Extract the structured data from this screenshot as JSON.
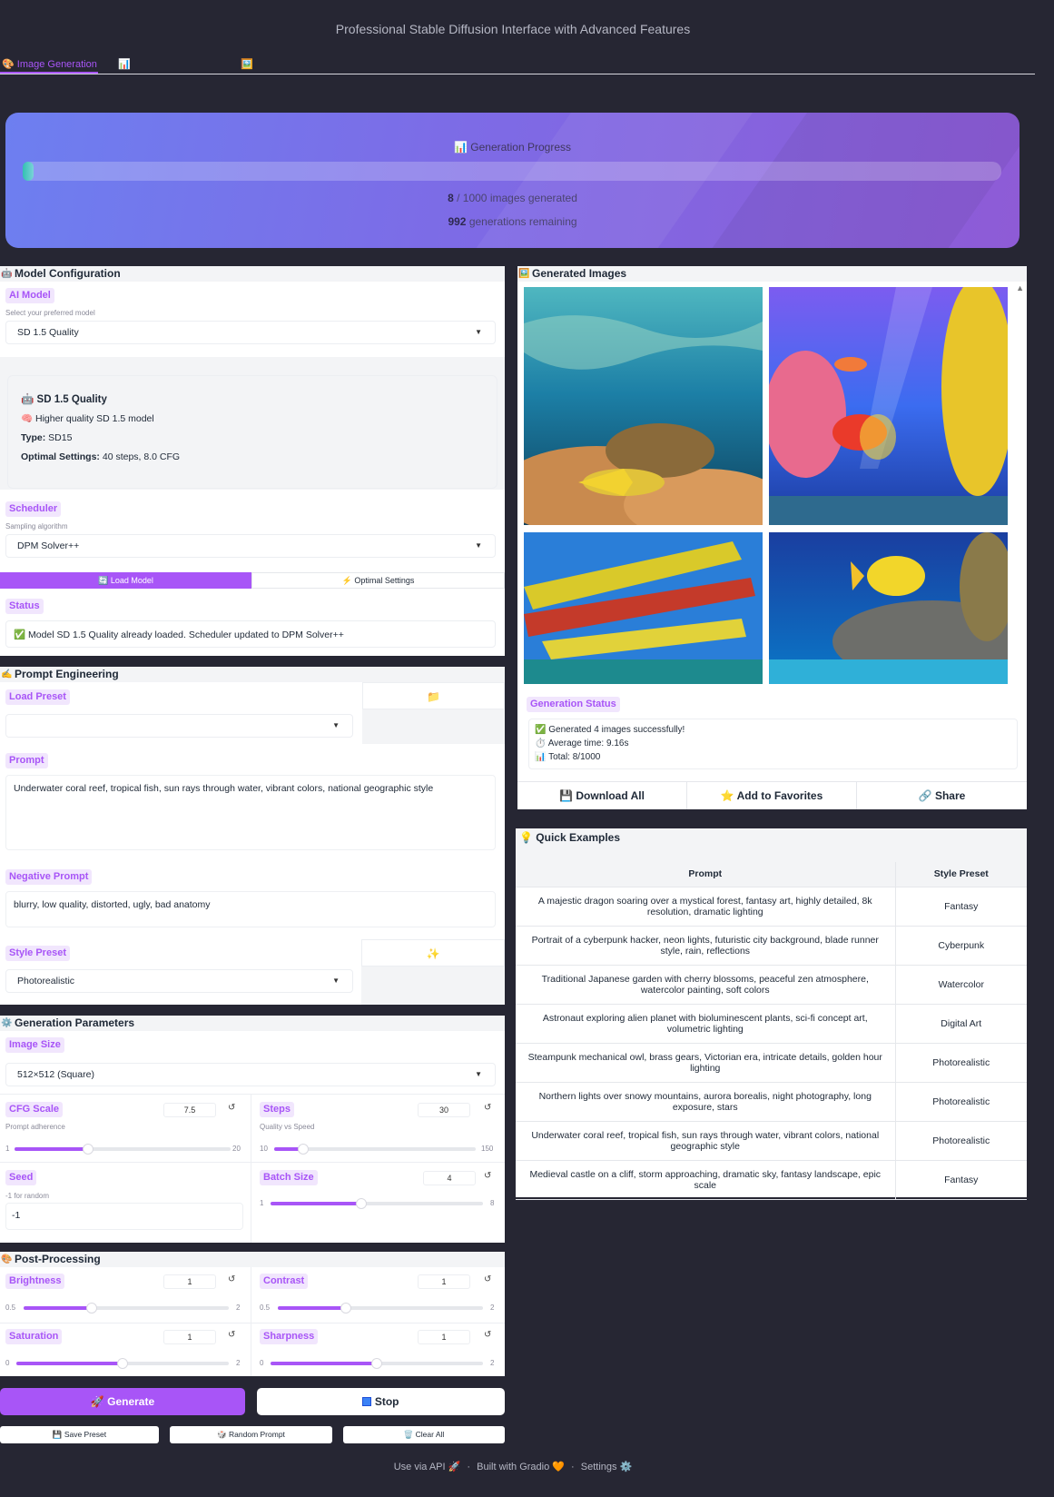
{
  "header": {
    "subtitle": "Professional Stable Diffusion Interface with Advanced Features",
    "tabs": [
      {
        "icon": "🎨",
        "label": "Image Generation"
      },
      {
        "icon": "📊",
        "label": ""
      },
      {
        "icon": "🖼️",
        "label": ""
      }
    ]
  },
  "progress": {
    "title": "📊 Generation Progress",
    "generated": "8",
    "total": "1000",
    "generated_suffix": "images generated",
    "remaining": "992",
    "remaining_suffix": "generations remaining",
    "fraction": 0.008
  },
  "model_config": {
    "title": "Model Configuration",
    "ai_model_label": "AI Model",
    "ai_model_hint": "Select your preferred model",
    "ai_model_value": "SD 1.5 Quality",
    "info_title": "SD 1.5 Quality",
    "info_desc": "Higher quality SD 1.5 model",
    "info_type_label": "Type:",
    "info_type_value": "SD15",
    "info_opt_label": "Optimal Settings:",
    "info_opt_value": "40 steps, 8.0 CFG",
    "scheduler_label": "Scheduler",
    "scheduler_hint": "Sampling algorithm",
    "scheduler_value": "DPM Solver++",
    "load_model_label": "🔄 Load Model",
    "optimal_settings_label": "⚡ Optimal Settings",
    "status_label": "Status",
    "status_text": "Model SD 1.5 Quality already loaded. Scheduler updated to DPM Solver++"
  },
  "prompt_eng": {
    "title": "Prompt Engineering",
    "load_preset_label": "Load Preset",
    "load_preset_value": "",
    "prompt_label": "Prompt",
    "prompt_value": "Underwater coral reef, tropical fish, sun rays through water, vibrant colors, national geographic style",
    "neg_label": "Negative Prompt",
    "neg_value": "blurry, low quality, distorted, ugly, bad anatomy",
    "style_label": "Style Preset",
    "style_value": "Photorealistic"
  },
  "gen_params": {
    "title": "Generation Parameters",
    "size_label": "Image Size",
    "size_value": "512×512 (Square)",
    "cfg": {
      "label": "CFG Scale",
      "hint": "Prompt adherence",
      "value": "7.5",
      "min": "1",
      "max": "20",
      "fraction": 0.342
    },
    "steps": {
      "label": "Steps",
      "hint": "Quality vs Speed",
      "value": "30",
      "min": "10",
      "max": "150",
      "fraction": 0.143
    },
    "seed": {
      "label": "Seed",
      "hint": "-1 for random",
      "value": "-1"
    },
    "batch": {
      "label": "Batch Size",
      "value": "4",
      "min": "1",
      "max": "8",
      "fraction": 0.429
    }
  },
  "post": {
    "title": "Post-Processing",
    "brightness": {
      "label": "Brightness",
      "value": "1",
      "min": "0.5",
      "max": "2",
      "fraction": 0.333
    },
    "contrast": {
      "label": "Contrast",
      "value": "1",
      "min": "0.5",
      "max": "2",
      "fraction": 0.333
    },
    "saturation": {
      "label": "Saturation",
      "value": "1",
      "min": "0",
      "max": "2",
      "fraction": 0.5
    },
    "sharpness": {
      "label": "Sharpness",
      "value": "1",
      "min": "0",
      "max": "2",
      "fraction": 0.5
    }
  },
  "actions": {
    "generate": "🚀 Generate",
    "stop": "Stop",
    "save_preset": "💾 Save Preset",
    "random_prompt": "🎲 Random Prompt",
    "clear_all": "🗑️ Clear All"
  },
  "gallery": {
    "title": "Generated Images",
    "status_label": "Generation Status",
    "status_line1": "Generated 4 images successfully!",
    "status_line2": "Average time: 9.16s",
    "status_line3": "Total: 8/1000",
    "download_all": "Download All",
    "add_favorites": "Add to Favorites",
    "share": "Share"
  },
  "quick_examples": {
    "title": "Quick Examples",
    "headers": [
      "Prompt",
      "Style Preset"
    ],
    "rows": [
      [
        "A majestic dragon soaring over a mystical forest, fantasy art, highly detailed, 8k resolution, dramatic lighting",
        "Fantasy"
      ],
      [
        "Portrait of a cyberpunk hacker, neon lights, futuristic city background, blade runner style, rain, reflections",
        "Cyberpunk"
      ],
      [
        "Traditional Japanese garden with cherry blossoms, peaceful zen atmosphere, watercolor painting, soft colors",
        "Watercolor"
      ],
      [
        "Astronaut exploring alien planet with bioluminescent plants, sci-fi concept art, volumetric lighting",
        "Digital Art"
      ],
      [
        "Steampunk mechanical owl, brass gears, Victorian era, intricate details, golden hour lighting",
        "Photorealistic"
      ],
      [
        "Northern lights over snowy mountains, aurora borealis, night photography, long exposure, stars",
        "Photorealistic"
      ],
      [
        "Underwater coral reef, tropical fish, sun rays through water, vibrant colors, national geographic style",
        "Photorealistic"
      ],
      [
        "Medieval castle on a cliff, storm approaching, dramatic sky, fantasy landscape, epic scale",
        "Fantasy"
      ]
    ]
  },
  "footer": {
    "api": "Use via API 🚀",
    "built": "Built with Gradio 🧡",
    "settings": "Settings ⚙️"
  },
  "colors": {
    "accent": "#a855f7",
    "background": "#262633"
  }
}
